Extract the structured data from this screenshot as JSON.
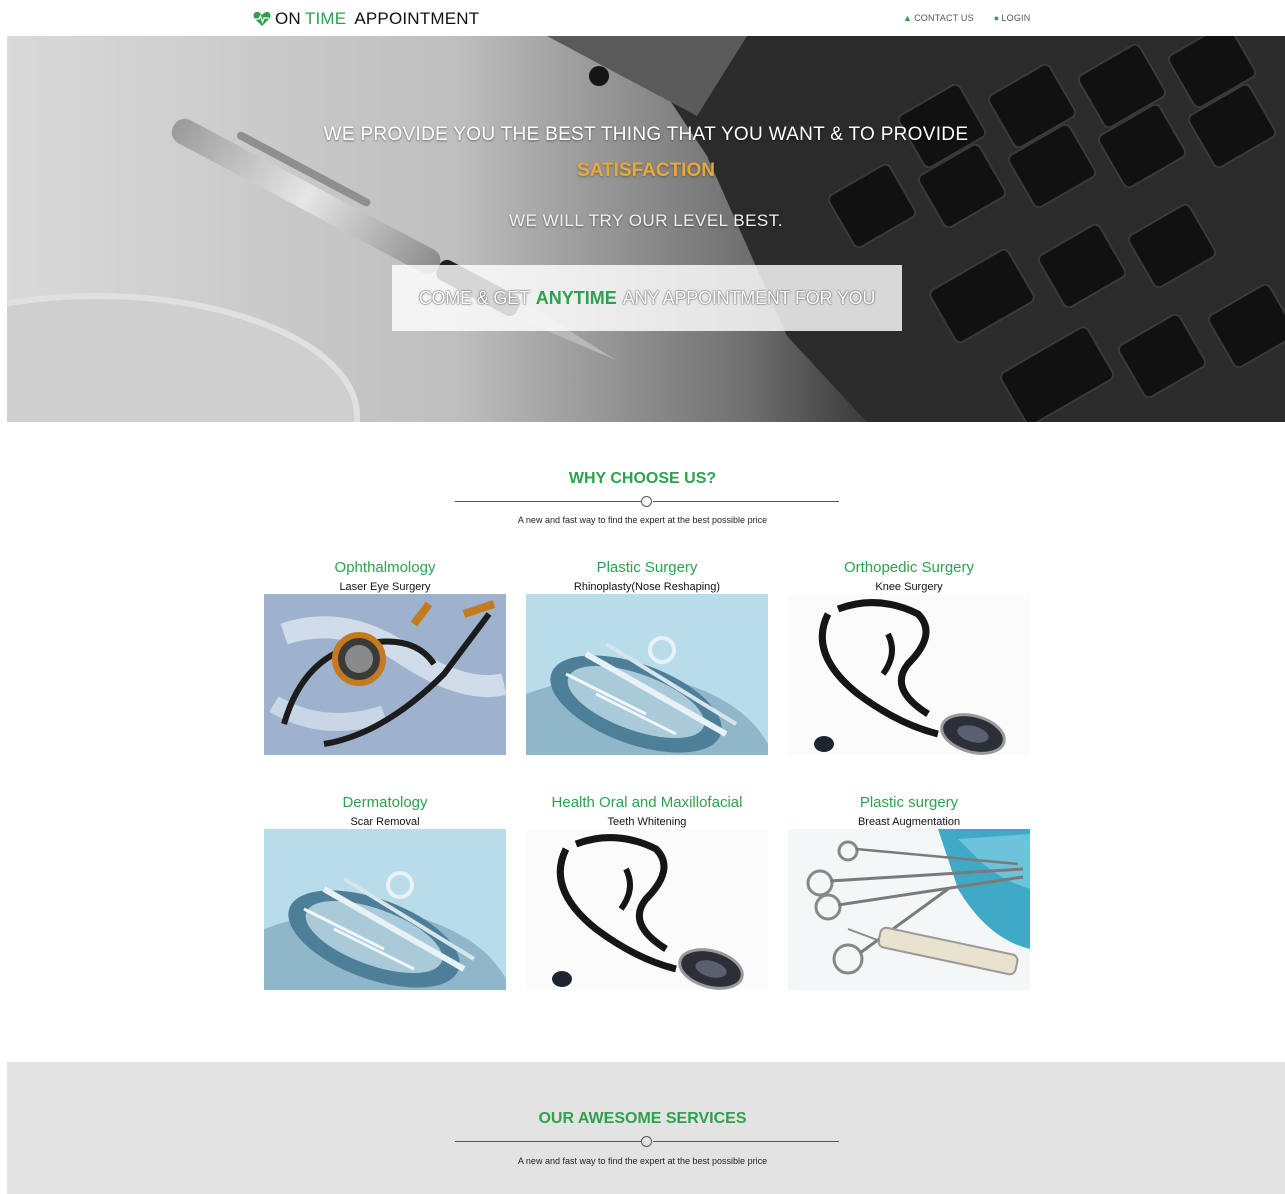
{
  "header": {
    "logo": {
      "part1": "ON",
      "part2": "TIME",
      "part3": "APPOINTMENT",
      "icon": "heart-pulse-icon"
    },
    "nav": [
      {
        "label": "CONTACT US",
        "icon": "lock-icon"
      },
      {
        "label": "LOGIN",
        "icon": "user-icon"
      }
    ]
  },
  "hero": {
    "title": "WE PROVIDE YOU THE BEST THING THAT YOU WANT & TO PROVIDE",
    "highlight": "SATISFACTION",
    "subtitle": "WE WILL TRY OUR LEVEL BEST.",
    "cta": {
      "before": "COME & GET",
      "strong": "ANYTIME",
      "after": "ANY APPOINTMENT FOR YOU"
    }
  },
  "why": {
    "title": "WHY CHOOSE US?",
    "subtitle": "A new and fast way to find the expert at the best possible price",
    "cards": [
      {
        "specialty": "Ophthalmology",
        "procedure": "Laser Eye Surgery",
        "image": "stethoscope-xray"
      },
      {
        "specialty": "Plastic Surgery",
        "procedure": "Rhinoplasty(Nose Reshaping)",
        "image": "surgical-tray"
      },
      {
        "specialty": "Orthopedic Surgery",
        "procedure": "Knee Surgery",
        "image": "stethoscope-white"
      },
      {
        "specialty": "Dermatology",
        "procedure": "Scar Removal",
        "image": "surgical-tray"
      },
      {
        "specialty": "Health Oral and Maxillofacial",
        "procedure": "Teeth Whitening",
        "image": "stethoscope-white"
      },
      {
        "specialty": "Plastic surgery",
        "procedure": "Breast Augmentation",
        "image": "scissors-syringe"
      }
    ]
  },
  "services": {
    "title": "OUR AWESOME SERVICES",
    "subtitle": "A new and fast way to find the expert at the best possible price"
  },
  "colors": {
    "accent": "#2ca24e",
    "highlight": "#e8a83c",
    "band": "#e3e3e3"
  }
}
